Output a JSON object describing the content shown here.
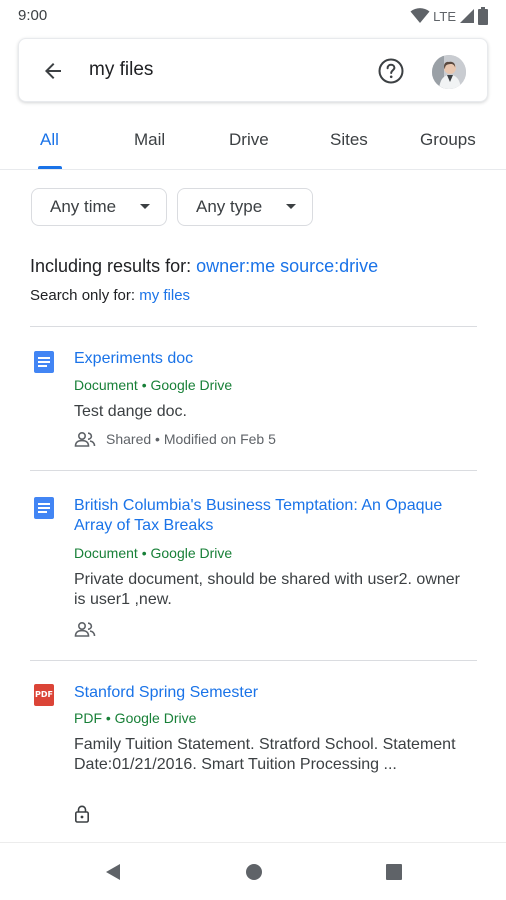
{
  "status_bar": {
    "time": "9:00",
    "network": "LTE"
  },
  "search": {
    "query": "my files"
  },
  "icons": {
    "back": "arrow-back-icon",
    "help": "help-circle-icon",
    "avatar": "account-avatar",
    "doc": "google-docs-icon",
    "pdf": "pdf-icon",
    "shared": "people-icon",
    "lock": "lock-icon"
  },
  "tabs": [
    {
      "label": "All",
      "active": true
    },
    {
      "label": "Mail",
      "active": false
    },
    {
      "label": "Drive",
      "active": false
    },
    {
      "label": "Sites",
      "active": false
    },
    {
      "label": "Groups",
      "active": false
    }
  ],
  "filters": [
    {
      "label": "Any time"
    },
    {
      "label": "Any type"
    }
  ],
  "including": {
    "prefix": "Including results for: ",
    "link": "owner:me source:drive"
  },
  "search_only": {
    "prefix": "Search only for: ",
    "link": "my files"
  },
  "results": [
    {
      "type": "doc",
      "title": "Experiments doc",
      "source": "Document • Google Drive",
      "snippet": "Test dange doc.",
      "meta": "Shared • Modified on Feb 5"
    },
    {
      "type": "doc",
      "title": "British Columbia's Business Temptation: An Opaque Array of Tax Breaks",
      "source": "Document • Google Drive",
      "snippet": "Private document, should be shared with user2. owner is user1 ,new.",
      "meta": ""
    },
    {
      "type": "pdf",
      "pdf_badge": "PDF",
      "title": "Stanford Spring Semester",
      "source": "PDF • Google Drive",
      "snippet": "Family Tuition Statement. Stratford School. Statement Date:01/21/2016. Smart Tuition Processing ...",
      "meta": ""
    }
  ],
  "colors": {
    "accent": "#1a73e8",
    "source_green": "#188038",
    "doc_blue": "#4285f4",
    "pdf_red": "#db4437"
  }
}
